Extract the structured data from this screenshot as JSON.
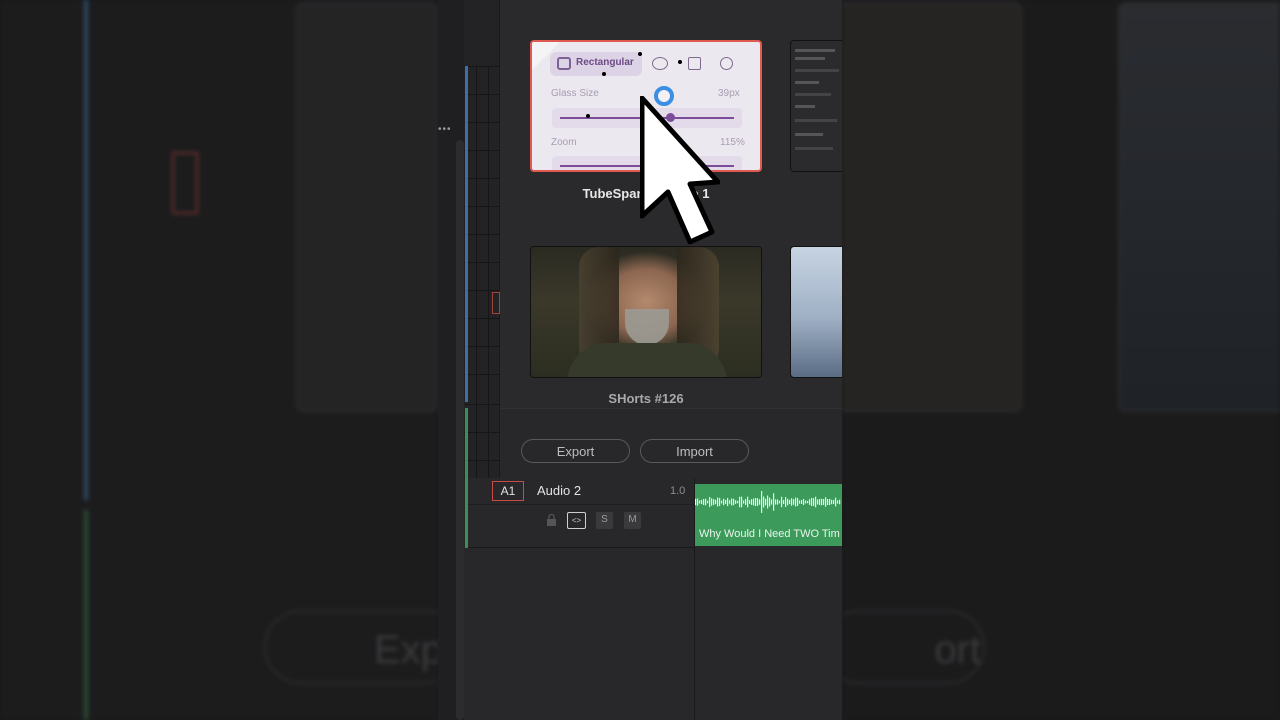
{
  "presets": {
    "items": [
      {
        "label": "TubeSpanner Preset 1",
        "visible_label": "TubeSpann… P…o 1",
        "selected": true
      },
      {
        "label": "SHorts #126",
        "selected": false
      }
    ]
  },
  "plugin_preview": {
    "shape_label": "Rectangular",
    "glass_size_label": "Glass Size",
    "glass_size_value": "39px",
    "zoom_label": "Zoom",
    "zoom_value": "115%",
    "glass_size_fraction": 0.63,
    "accent": "#7b4c9a"
  },
  "buttons": {
    "export": "Export",
    "import": "Import"
  },
  "audio_track": {
    "id": "A1",
    "name": "Audio 2",
    "level": "1.0",
    "solo": "S",
    "mute": "M",
    "clip_title": "Why Would I Need TWO Tim",
    "clip_color": "#3c9a5b"
  },
  "background": {
    "left_button": "Exp",
    "right_button": "ort"
  },
  "colors": {
    "selection_border": "#e05a52",
    "panel_bg": "#2a2a2c",
    "track_blue": "#3d6ea5",
    "track_green": "#3a8f52"
  }
}
